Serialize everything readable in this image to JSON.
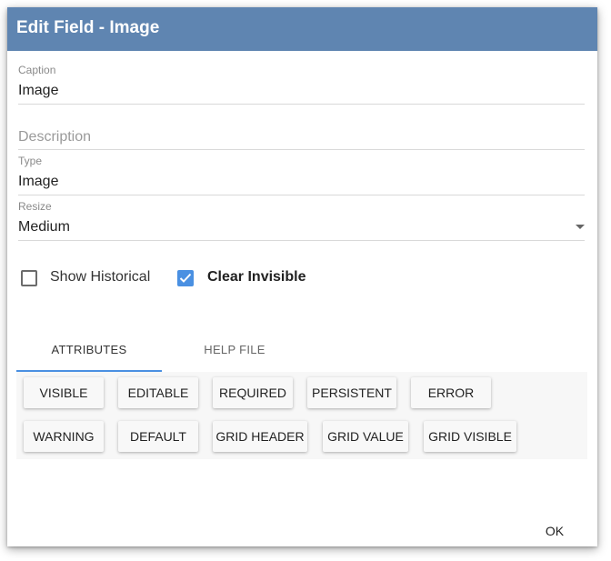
{
  "dialog": {
    "title": "Edit Field - Image"
  },
  "fields": {
    "caption": {
      "label": "Caption",
      "value": "Image"
    },
    "description": {
      "placeholder": "Description"
    },
    "type": {
      "label": "Type",
      "value": "Image"
    },
    "resize": {
      "label": "Resize",
      "value": "Medium"
    }
  },
  "checkboxes": {
    "show_historical": {
      "label": "Show Historical",
      "checked": false
    },
    "clear_invisible": {
      "label": "Clear Invisible",
      "checked": true
    }
  },
  "tabs": [
    {
      "label": "ATTRIBUTES",
      "active": true
    },
    {
      "label": "HELP FILE",
      "active": false
    }
  ],
  "attributes": [
    "VISIBLE",
    "EDITABLE",
    "REQUIRED",
    "PERSISTENT",
    "ERROR",
    "WARNING",
    "DEFAULT",
    "GRID HEADER",
    "GRID VALUE",
    "GRID VISIBLE"
  ],
  "footer": {
    "ok_label": "OK"
  },
  "colors": {
    "titlebar": "#5f85b1",
    "accent": "#4a90e2"
  },
  "icons": {
    "checkbox_checked": "check-icon",
    "dropdown": "chevron-down-icon"
  }
}
